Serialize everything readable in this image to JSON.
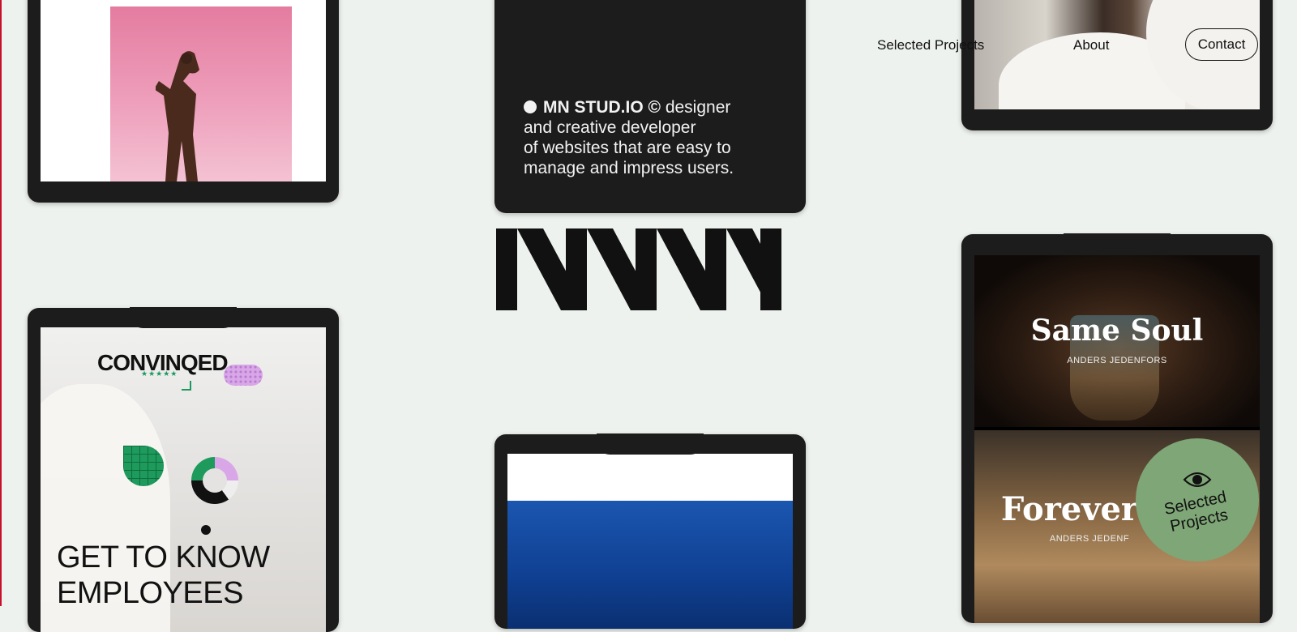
{
  "nav": {
    "selected_projects": "Selected Projects",
    "about": "About",
    "contact": "Contact"
  },
  "studio": {
    "brand": "MN STUD.IO ©",
    "description": "designer\nand creative developer\nof websites that are easy to\nmanage and impress users."
  },
  "convinced": {
    "logo": "CONVINQED",
    "stars": "★★★★★",
    "heading": "GET TO KNOW\nEMPLOYEES"
  },
  "same_soul": {
    "title_1": "Same Soul",
    "subtitle_1": "ANDERS JEDENFORS",
    "title_2": "Forever y",
    "subtitle_2": "ANDERS JEDENF"
  },
  "badge": {
    "text": "Selected\nProjects",
    "icon": "eye-icon"
  },
  "colors": {
    "background": "#eef2ee",
    "phone_frame": "#1c1c1c",
    "badge": "#7fa676",
    "accent_green": "#1d9a5c",
    "accent_purple": "#d9a7e8"
  }
}
